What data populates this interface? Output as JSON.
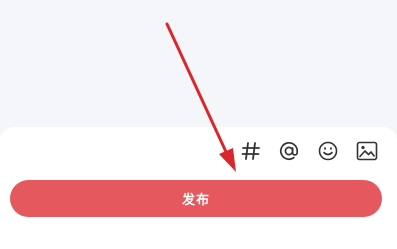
{
  "toolbar": {
    "icons": [
      "hash-icon",
      "at-icon",
      "emoji-icon",
      "image-icon"
    ]
  },
  "actions": {
    "publish_label": "发布"
  },
  "colors": {
    "publish_button": "#e5585d",
    "annotation_arrow": "#d9282b",
    "background_top": "#f5f6f9",
    "panel": "#ffffff",
    "icon": "#333333"
  }
}
